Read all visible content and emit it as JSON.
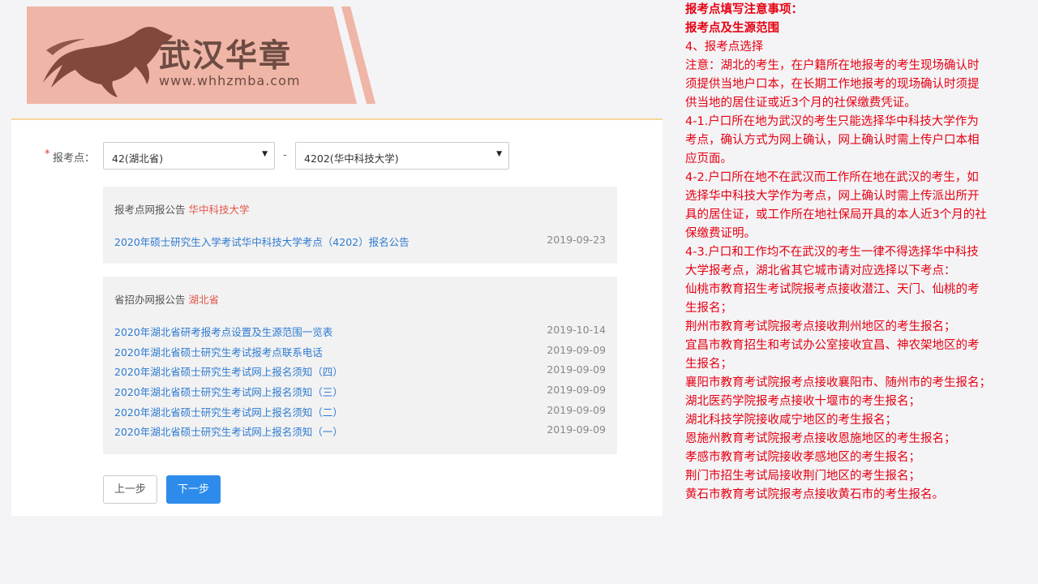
{
  "logo": {
    "name_cn": "武汉华章",
    "url": "www.whhzmba.com",
    "accent_color": "#efb5a6"
  },
  "form": {
    "site_label": "报考点：",
    "required_mark": "*",
    "province_select": {
      "value": "42(湖北省)"
    },
    "dash": "-",
    "site_select": {
      "value": "4202(华中科技大学)"
    },
    "caret": "▼"
  },
  "site_notice": {
    "title": "报考点网报公告",
    "title_highlight": "华中科技大学",
    "items": [
      {
        "text": "2020年硕士研究生入学考试华中科技大学考点（4202）报名公告",
        "date": "2019-09-23"
      }
    ]
  },
  "province_notice": {
    "title": "省招办网报公告",
    "title_highlight": "湖北省",
    "items": [
      {
        "text": "2020年湖北省研考报考点设置及生源范围一览表",
        "date": "2019-10-14"
      },
      {
        "text": "2020年湖北省硕士研究生考试报考点联系电话",
        "date": "2019-09-09"
      },
      {
        "text": "2020年湖北省硕士研究生考试网上报名须知（四）",
        "date": "2019-09-09"
      },
      {
        "text": "2020年湖北省硕士研究生考试网上报名须知（三）",
        "date": "2019-09-09"
      },
      {
        "text": "2020年湖北省硕士研究生考试网上报名须知（二）",
        "date": "2019-09-09"
      },
      {
        "text": "2020年湖北省硕士研究生考试网上报名须知（一）",
        "date": "2019-09-09"
      }
    ]
  },
  "buttons": {
    "prev": "上一步",
    "next": "下一步"
  },
  "notes": {
    "heading1": "报考点填写注意事项：",
    "heading2": "报考点及生源范围",
    "lines": [
      "4、报考点选择",
      "注意：湖北的考生，在户籍所在地报考的考生现场确认时",
      "须提供当地户口本，在长期工作地报考的现场确认时须提",
      "供当地的居住证或近3个月的社保缴费凭证。",
      "4-1.户口所在地为武汉的考生只能选择华中科技大学作为",
      "考点，确认方式为网上确认，网上确认时需上传户口本相",
      "应页面。",
      "4-2.户口所在地不在武汉而工作所在地在武汉的考生，如",
      "选择华中科技大学作为考点，网上确认时需上传派出所开",
      "具的居住证，或工作所在地社保局开具的本人近3个月的社",
      "保缴费证明。",
      "4-3.户口和工作均不在武汉的考生一律不得选择华中科技",
      "大学报考点，湖北省其它城市请对应选择以下考点：",
      "仙桃市教育招生考试院报考点接收潜江、天门、仙桃的考",
      "生报名；",
      "荆州市教育考试院报考点接收荆州地区的考生报名；",
      "宜昌市教育招生和考试办公室接收宜昌、神农架地区的考",
      "生报名；",
      "襄阳市教育考试院报考点接收襄阳市、随州市的考生报名；",
      "湖北医药学院报考点接收十堰市的考生报名；",
      "湖北科技学院接收咸宁地区的考生报名；",
      "恩施州教育考试院报考点接收恩施地区的考生报名；",
      "孝感市教育考试院接收孝感地区的考生报名；",
      "荆门市招生考试局接收荆门地区的考生报名；",
      "黄石市教育考试院报考点接收黄石市的考生报名。"
    ]
  }
}
